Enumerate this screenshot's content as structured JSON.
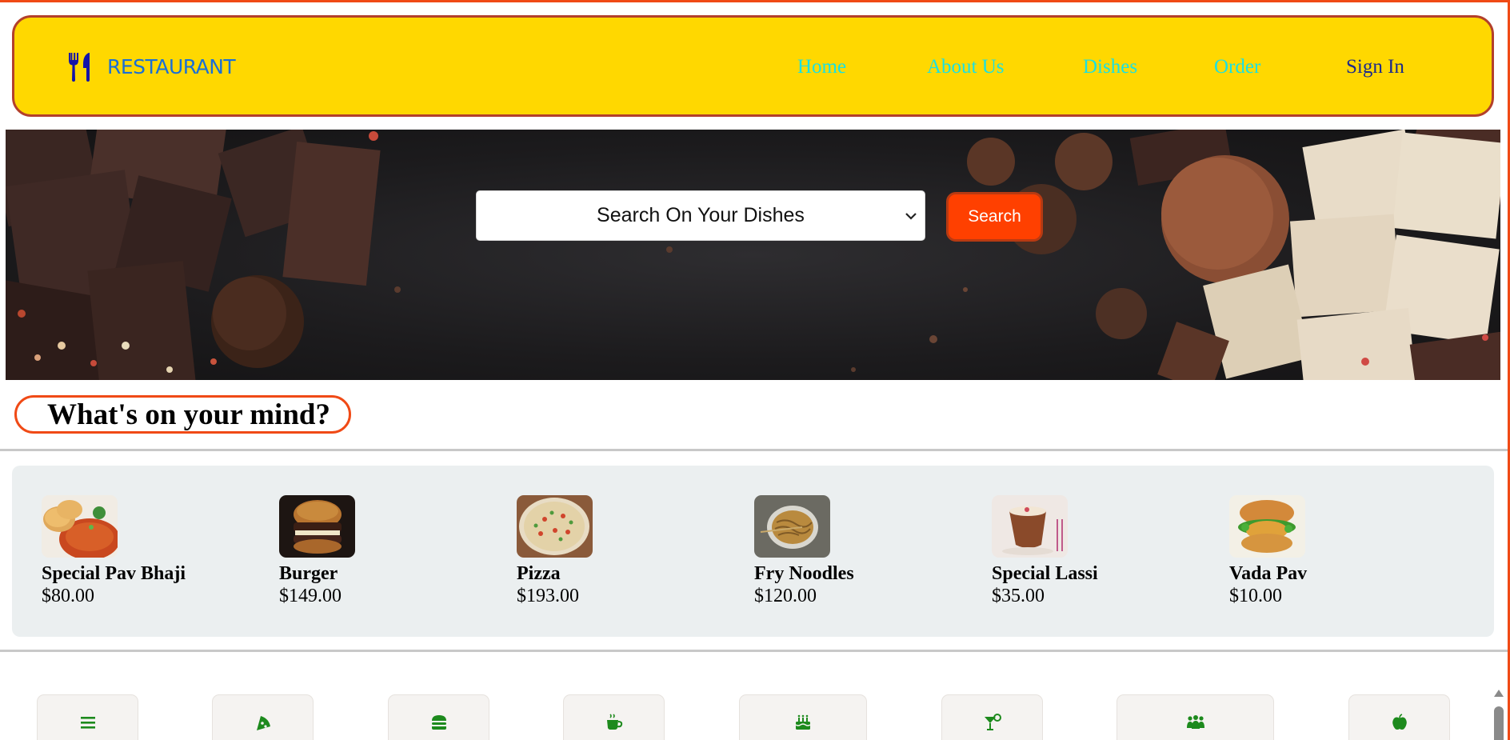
{
  "brand": {
    "name": "RESTAURANT",
    "icon": "fork-knife-icon",
    "color": "#1a6fd6"
  },
  "nav": {
    "links": [
      {
        "label": "Home"
      },
      {
        "label": "About Us"
      },
      {
        "label": "Dishes"
      },
      {
        "label": "Order"
      }
    ],
    "signin_label": "Sign In",
    "link_color": "#19e0e4",
    "background": "#ffd800"
  },
  "search": {
    "select_value": "Search On Your Dishes",
    "button_label": "Search",
    "button_color": "#ff4000"
  },
  "mind": {
    "title": "What's on your mind?"
  },
  "dishes": [
    {
      "name": "Special Pav Bhaji",
      "price": "$80.00"
    },
    {
      "name": "Burger",
      "price": "$149.00"
    },
    {
      "name": "Pizza",
      "price": "$193.00"
    },
    {
      "name": "Fry Noodles",
      "price": "$120.00"
    },
    {
      "name": "Special Lassi",
      "price": "$35.00"
    },
    {
      "name": "Vada Pav",
      "price": "$10.00"
    }
  ],
  "categories": [
    {
      "icon": "menu-bars-icon"
    },
    {
      "icon": "pizza-slice-icon"
    },
    {
      "icon": "burger-icon"
    },
    {
      "icon": "coffee-cup-icon"
    },
    {
      "icon": "birthday-cake-icon"
    },
    {
      "icon": "cocktail-icon"
    },
    {
      "icon": "people-group-icon"
    },
    {
      "icon": "apple-icon"
    }
  ],
  "accent_color": "#f04a16",
  "category_icon_color": "#1d8a1d"
}
